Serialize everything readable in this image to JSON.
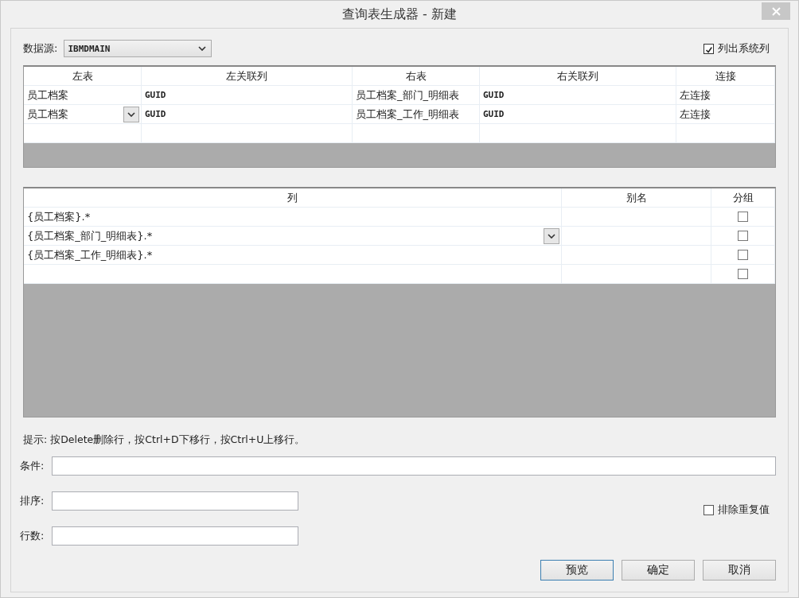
{
  "window": {
    "title": "查询表生成器 - 新建"
  },
  "datasource": {
    "label": "数据源:",
    "value": "IBMDMAIN"
  },
  "show_system_columns": {
    "label": "列出系统列",
    "checked": true
  },
  "joins": {
    "columns": [
      "左表",
      "左关联列",
      "右表",
      "右关联列",
      "连接"
    ],
    "rows": [
      {
        "cells": [
          "员工档案",
          "GUID",
          "员工档案_部门_明细表",
          "GUID",
          "左连接"
        ],
        "dropdown_shown": false
      },
      {
        "cells": [
          "员工档案",
          "GUID",
          "员工档案_工作_明细表",
          "GUID",
          "左连接"
        ],
        "dropdown_shown": true
      }
    ]
  },
  "select": {
    "columns": [
      "列",
      "别名",
      "分组"
    ],
    "rows": [
      {
        "column": "{员工档案}.*",
        "grouped": false,
        "dropdown_shown": false
      },
      {
        "column": "{员工档案_部门_明细表}.*",
        "grouped": false,
        "dropdown_shown": true
      },
      {
        "column": "{员工档案_工作_明细表}.*",
        "grouped": false,
        "dropdown_shown": false
      },
      {
        "grouped": false,
        "dropdown_shown": false
      }
    ]
  },
  "hint": "提示: 按Delete删除行，按Ctrl+D下移行，按Ctrl+U上移行。",
  "fields": [
    {
      "label": "条件:",
      "kind": "wide"
    },
    {
      "label": "排序:",
      "kind": "short"
    },
    {
      "label": "行数:",
      "kind": "short"
    }
  ],
  "distinct": {
    "label": "排除重复值",
    "checked": false
  },
  "buttons": [
    {
      "label": "预览",
      "default": true
    },
    {
      "label": "确定",
      "default": false
    },
    {
      "label": "取消",
      "default": false
    }
  ]
}
